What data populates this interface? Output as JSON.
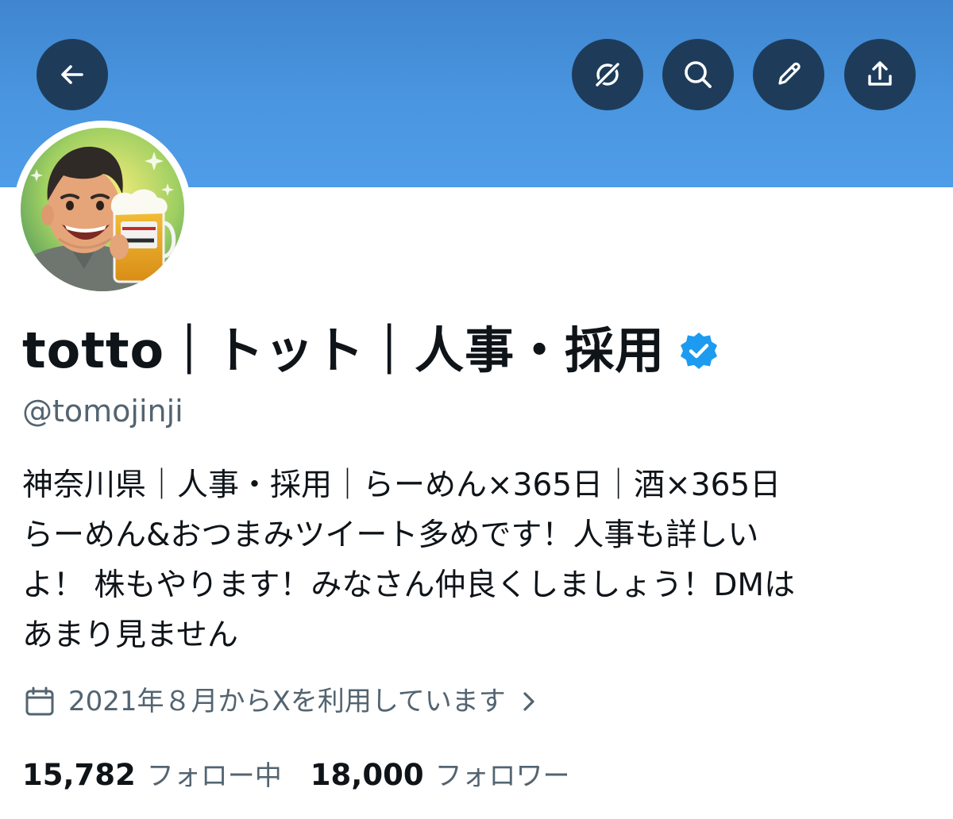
{
  "header": {
    "back_button_icon": "arrow-left-icon",
    "grok_button_icon": "grok-icon",
    "search_button_icon": "search-icon",
    "edit_button_icon": "pencil-icon",
    "share_button_icon": "share-upload-icon",
    "button_color": "#1e3c5a",
    "banner_color": "#4a96e0"
  },
  "profile": {
    "display_name": "totto｜トット｜人事・採用",
    "verified": true,
    "verified_color": "#1d9bf0",
    "handle": "@tomojinji",
    "bio_lines": [
      "神奈川県｜人事・採用｜らーめん×365日｜酒×365日",
      "らーめん&おつまみツイート多めです！人事も詳しい",
      "よ！ 株もやります！みなさん仲良くしましょう！DMは",
      "あまり見ません"
    ],
    "joined_icon": "calendar-icon",
    "joined_text": "2021年８月からXを利用しています"
  },
  "stats": {
    "following_count": "15,782",
    "following_label": "フォロー中",
    "followers_count": "18,000",
    "followers_label": "フォロワー"
  }
}
